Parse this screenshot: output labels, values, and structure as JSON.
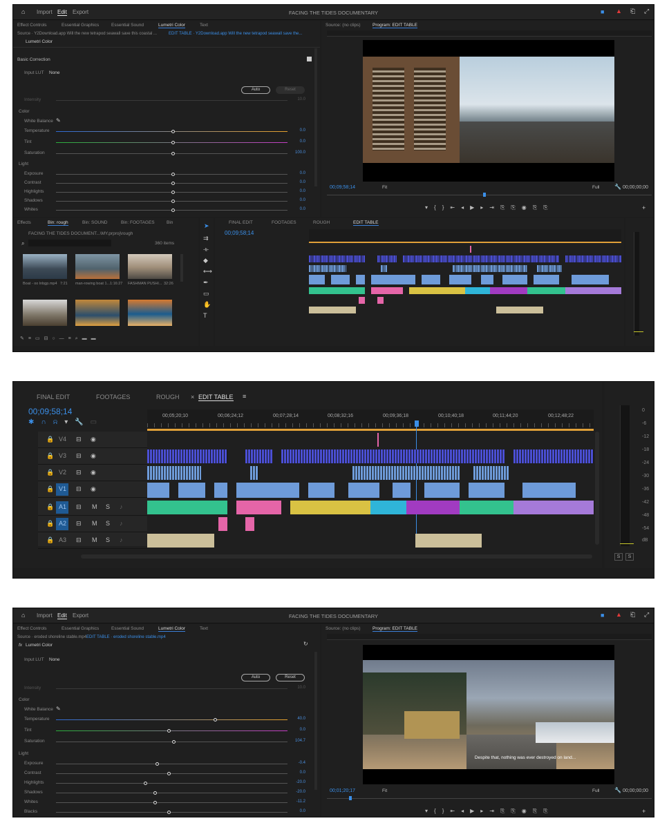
{
  "colors": {
    "accent": "#3b8fe8",
    "video_clip": "#6e9bd9",
    "v3_clip": "#4b4fd4",
    "audio_green": "#33c28e",
    "audio_pink": "#e565a8",
    "audio_yellow": "#d9c243",
    "audio_purple": "#a57ad9",
    "audio_tan": "#cbbf9a"
  },
  "s1": {
    "nav": {
      "import": "Import",
      "edit": "Edit",
      "export": "Export"
    },
    "project_title": "FACING THE TIDES DOCUMENTARY",
    "tabs": [
      "Effect Controls",
      "Essential Graphics",
      "Essential Sound",
      "Lumetri Color",
      "Text"
    ],
    "source_line": "Source · Y2Download.app Will the new tetrapod seawall save this coastal ...",
    "seq_line": "EDIT TABLE · Y2Download.app Will the new tetrapod seawall save the...",
    "effect_name": "Lumetri Color",
    "basic_correction": "Basic Correction",
    "input_lut_label": "Input LUT",
    "input_lut_value": "None",
    "auto_btn": "Auto",
    "reset_btn": "Reset",
    "intensity": "Intensity",
    "intensity_val": "10.0",
    "color_group": "Color",
    "white_balance": "White Balance",
    "params": [
      {
        "name": "Temperature",
        "value": "0.0",
        "pos": 0.48
      },
      {
        "name": "Tint",
        "value": "0.0",
        "pos": 0.48
      },
      {
        "name": "Saturation",
        "value": "100.0",
        "pos": 0.48
      }
    ],
    "light_group": "Light",
    "light_params": [
      {
        "name": "Exposure",
        "value": "0.0",
        "pos": 0.48
      },
      {
        "name": "Contrast",
        "value": "0.0",
        "pos": 0.48
      },
      {
        "name": "Highlights",
        "value": "0.0",
        "pos": 0.48
      },
      {
        "name": "Shadows",
        "value": "0.0",
        "pos": 0.48
      },
      {
        "name": "Whites",
        "value": "0.0",
        "pos": 0.48
      }
    ],
    "program_tabs": [
      "Source: (no clips)",
      "Program: EDIT TABLE"
    ],
    "program_timecode": "00;09;58;14",
    "fit": "Fit",
    "full": "Full",
    "out_timecode": "00;00;00;00",
    "bin_tabs": [
      "Effects",
      "Bin: rough",
      "Bin: SOUND",
      "Bin: FOOTAGES",
      "Bin"
    ],
    "bin_path": "FACING THE TIDES DOCUMENT...\\MY.prproj\\rough",
    "bin_count": "360 items",
    "thumbs": [
      {
        "name": "Boat - oo lnbgp.mp4",
        "dur": "7:21"
      },
      {
        "name": "man-rowing boat 1...",
        "dur": "1:16:27"
      },
      {
        "name": "FASHMAN PUSHI...",
        "dur": "32:26"
      }
    ],
    "seq_tabs": [
      "FINAL EDIT",
      "FOOTAGES",
      "ROUGH",
      "EDIT TABLE"
    ],
    "seq_timecode": "00;09;58;14"
  },
  "s2": {
    "tabs": [
      "FINAL EDIT",
      "FOOTAGES",
      "ROUGH",
      "EDIT TABLE"
    ],
    "timecode": "00;09;58;14",
    "ruler": [
      "00;05;20;10",
      "00;06;24;12",
      "00;07;28;14",
      "00;08;32;16",
      "00;09;36;18",
      "00;10;40;18",
      "00;11;44;20",
      "00;12;48;22"
    ],
    "tracks": [
      "V4",
      "V3",
      "V2",
      "V1",
      "A1",
      "A2",
      "A3"
    ],
    "audio_btns": {
      "m": "M",
      "s": "S"
    },
    "meter": [
      "0",
      "-6",
      "-12",
      "-18",
      "-24",
      "-30",
      "-36",
      "-42",
      "-48",
      "-54",
      "dB"
    ],
    "solo": [
      "S",
      "S"
    ]
  },
  "s3": {
    "source_line": "Source · eroded shoreline stable.mp4",
    "seq_line": "EDIT TABLE · eroded shoreline stable.mp4",
    "effect_name": "Lumetri Color",
    "input_lut_label": "Input LUT",
    "input_lut_value": "None",
    "auto_btn": "Auto",
    "reset_btn": "Reset",
    "intensity": "Intensity",
    "intensity_val": "10.0",
    "color_group": "Color",
    "white_balance": "White Balance",
    "params": [
      {
        "name": "Temperature",
        "value": "40.0",
        "pos": 0.68
      },
      {
        "name": "Tint",
        "value": "0.0",
        "pos": 0.48
      },
      {
        "name": "Saturation",
        "value": "104.7",
        "pos": 0.5
      }
    ],
    "light_group": "Light",
    "light_params": [
      {
        "name": "Exposure",
        "value": "-0.4",
        "pos": 0.43
      },
      {
        "name": "Contrast",
        "value": "0.0",
        "pos": 0.48
      },
      {
        "name": "Highlights",
        "value": "-20.0",
        "pos": 0.38
      },
      {
        "name": "Shadows",
        "value": "-20.0",
        "pos": 0.42
      },
      {
        "name": "Whites",
        "value": "-11.2",
        "pos": 0.42
      },
      {
        "name": "Blacks",
        "value": "0.0",
        "pos": 0.48
      }
    ],
    "program_timecode": "00;01;20;17",
    "fit": "Fit",
    "full": "Full",
    "out_timecode": "00;00;00;00",
    "subtitle": "Despite that, nothing was ever destroyed on land..."
  }
}
